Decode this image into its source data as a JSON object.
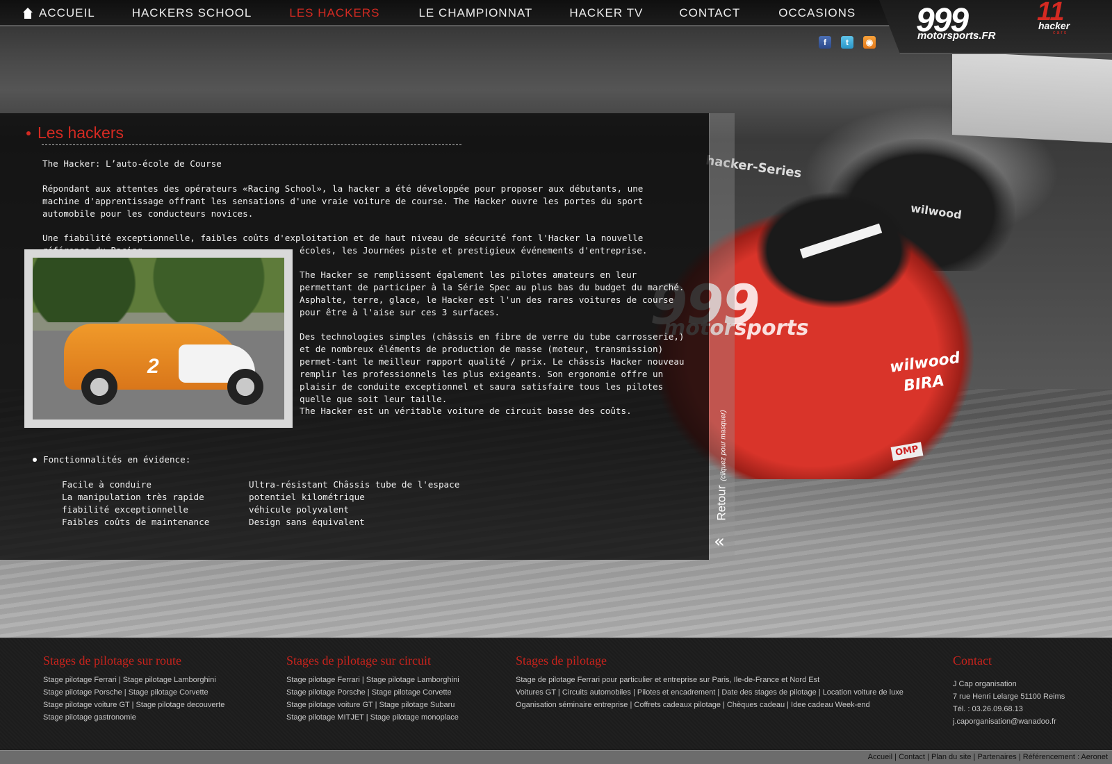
{
  "nav": {
    "items": [
      {
        "label": "ACCUEIL",
        "active": false
      },
      {
        "label": "HACKERS SCHOOL",
        "active": false
      },
      {
        "label": "LES HACKERS",
        "active": true
      },
      {
        "label": "LE CHAMPIONNAT",
        "active": false
      },
      {
        "label": "HACKER TV",
        "active": false
      },
      {
        "label": "CONTACT",
        "active": false
      },
      {
        "label": "OCCASIONS",
        "active": false
      }
    ]
  },
  "social": {
    "icons": [
      "facebook-icon",
      "twitter-icon",
      "rss-icon"
    ]
  },
  "logo": {
    "main": "999",
    "sub": "motorsports.FR",
    "hacker_number": "11",
    "hacker_text": "hacker",
    "hacker_sub": "cars"
  },
  "hero": {
    "car_main_logo": "999",
    "car_main_sub": "motorsports",
    "sponsor1": "wilwood",
    "sponsor2": "BIRA",
    "sponsor3": "OMP",
    "windshield": "hacker-Series",
    "dark_car_brand": "wilwood"
  },
  "content": {
    "title": "Les hackers",
    "subtitle": "The Hacker: L’auto-école de Course",
    "p1": "Répondant aux attentes des opérateurs «Racing School», la hacker a été développée pour proposer aux débutants, une machine d'apprentissage offrant les sensations d'une vraie voiture de course. The Hacker ouvre les portes du sport automobile pour les conducteurs novices.",
    "p2a": "Une fiabilité exceptionnelle, faibles coûts d'exploitation et de haut niveau de sécurité font l'Hacker la nouvelle référence du Racing",
    "p2b": "écoles, les Journées piste et prestigieux événements d'entreprise.",
    "p3a": "The Hacker se remplissent également les pilotes amateurs en leur permettant de participer à la Série Spec au plus bas du budget du marché.",
    "p3b": "Asphalte, terre, glace, le Hacker est l'un des rares voitures de course pour être à l'aise sur ces 3 surfaces.",
    "p4": "Des technologies simples (châssis en fibre de verre du tube carrosserie,) et de nombreux éléments de production de masse (moteur, transmission) permet-tant le meilleur rapport qualité / prix. Le châssis Hacker nouveau remplir les professionnels les plus exigeants. Son ergonomie offre un plaisir de conduite exceptionnel et saura satisfaire tous les pilotes quelle que soit leur taille.",
    "p5": "The Hacker est un véritable voiture de circuit basse des coûts.",
    "photo_number": "2",
    "features_title": "Fonctionnalités en évidence:",
    "features_col1": [
      "Facile à conduire",
      "La manipulation très rapide",
      "fiabilité exceptionnelle",
      "Faibles coûts de maintenance"
    ],
    "features_col2": [
      "Ultra-résistant Châssis tube de l'espace",
      "potentiel kilométrique",
      "véhicule polyvalent",
      "Design sans équivalent"
    ],
    "retour_label": "Retour",
    "retour_hint": "(cliquez pour masquer)"
  },
  "footer": {
    "col1": {
      "title": "Stages de pilotage sur route",
      "links": [
        "Stage pilotage Ferrari | Stage pilotage Lamborghini",
        "Stage pilotage Porsche | Stage pilotage Corvette",
        "Stage pilotage voiture GT | Stage pilotage decouverte",
        "Stage pilotage gastronomie"
      ]
    },
    "col2": {
      "title": "Stages de pilotage sur circuit",
      "links": [
        "Stage pilotage Ferrari | Stage pilotage Lamborghini",
        "Stage pilotage Porsche | Stage pilotage Corvette",
        "Stage pilotage voiture GT | Stage pilotage Subaru",
        "Stage pilotage MITJET | Stage pilotage monoplace"
      ]
    },
    "col3": {
      "title": "Stages de pilotage",
      "links": [
        "Stage de pilotage Ferrari pour particulier et entreprise sur Paris, Ile-de-France et Nord Est",
        "Voitures GT | Circuits automobiles | Pilotes et encadrement | Date des stages de pilotage | Location voiture de luxe",
        "Oganisation séminaire entreprise | Coffrets cadeaux pilotage | Chèques cadeau | Idee cadeau Week-end"
      ]
    },
    "col4": {
      "title": "Contact",
      "lines": [
        "J Cap organisation",
        "7 rue Henri Lelarge 51100 Reims",
        "Tél. : 03.26.09.68.13",
        "j.caporganisation@wanadoo.fr"
      ]
    }
  },
  "bottom_links": [
    "Accueil",
    "Contact",
    "Plan du site",
    "Partenaires",
    "Référencement : Aeronet"
  ]
}
